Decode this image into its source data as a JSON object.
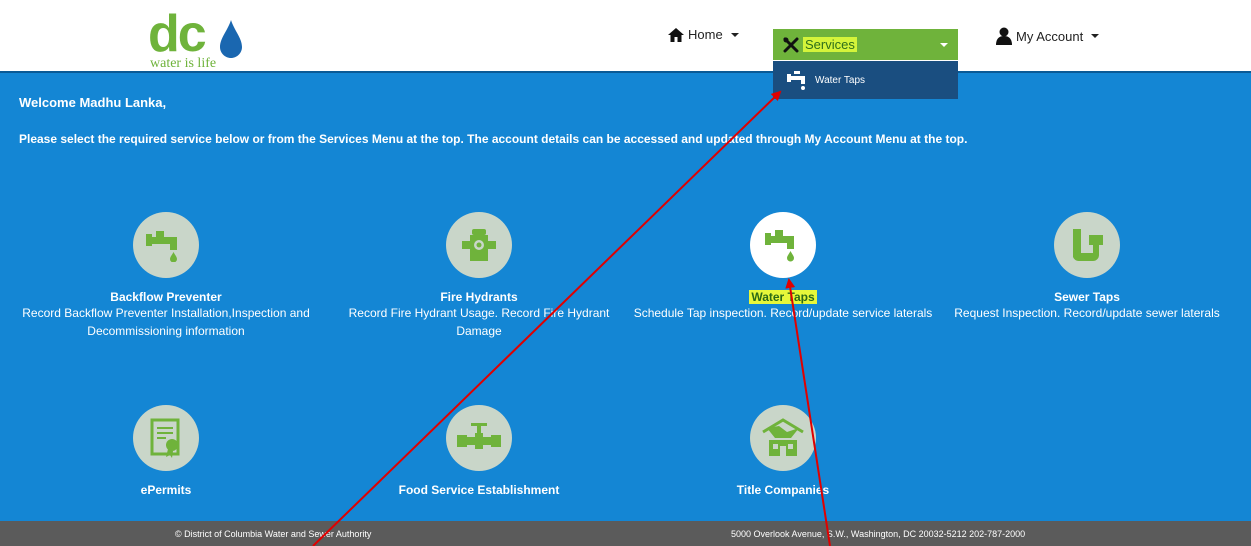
{
  "logo": {
    "letters": "dc",
    "tagline": "water is life"
  },
  "nav": {
    "home_label": "Home",
    "services_label": "Services",
    "account_label": "My Account",
    "dropdown_item": "Water Taps"
  },
  "main": {
    "welcome": "Welcome Madhu Lanka,",
    "instructions": "Please select the required service below or from the Services Menu at the top. The account details can be accessed and updated through My Account Menu at the top."
  },
  "services": [
    {
      "title": "Backflow Preventer",
      "desc": "Record Backflow Preventer Installation,Inspection and Decommissioning information",
      "icon": "faucet-icon"
    },
    {
      "title": "Fire Hydrants",
      "desc": "Record Fire Hydrant Usage. Record Fire Hydrant Damage",
      "icon": "hydrant-icon"
    },
    {
      "title": "Water Taps",
      "desc": "Schedule Tap inspection. Record/update service laterals",
      "icon": "water-tap-icon"
    },
    {
      "title": "Sewer Taps",
      "desc": "Request Inspection. Record/update sewer laterals",
      "icon": "sewer-pipe-icon"
    },
    {
      "title": "ePermits",
      "desc": "",
      "icon": "certificate-icon"
    },
    {
      "title": "Food Service Establishment",
      "desc": "",
      "icon": "valve-icon"
    },
    {
      "title": "Title Companies",
      "desc": "",
      "icon": "handshake-house-icon"
    }
  ],
  "footer": {
    "copyright": "© District of Columbia Water and Sewer Authority",
    "address": "5000 Overlook Avenue, S.W., Washington, DC 20032-5212 202-787-2000"
  },
  "colors": {
    "brand_green": "#6fb33b",
    "main_blue": "#1486d4",
    "dropdown_blue": "#1a4e80",
    "highlight_yellow": "#e6f73a",
    "annotation_red": "#e00000"
  }
}
